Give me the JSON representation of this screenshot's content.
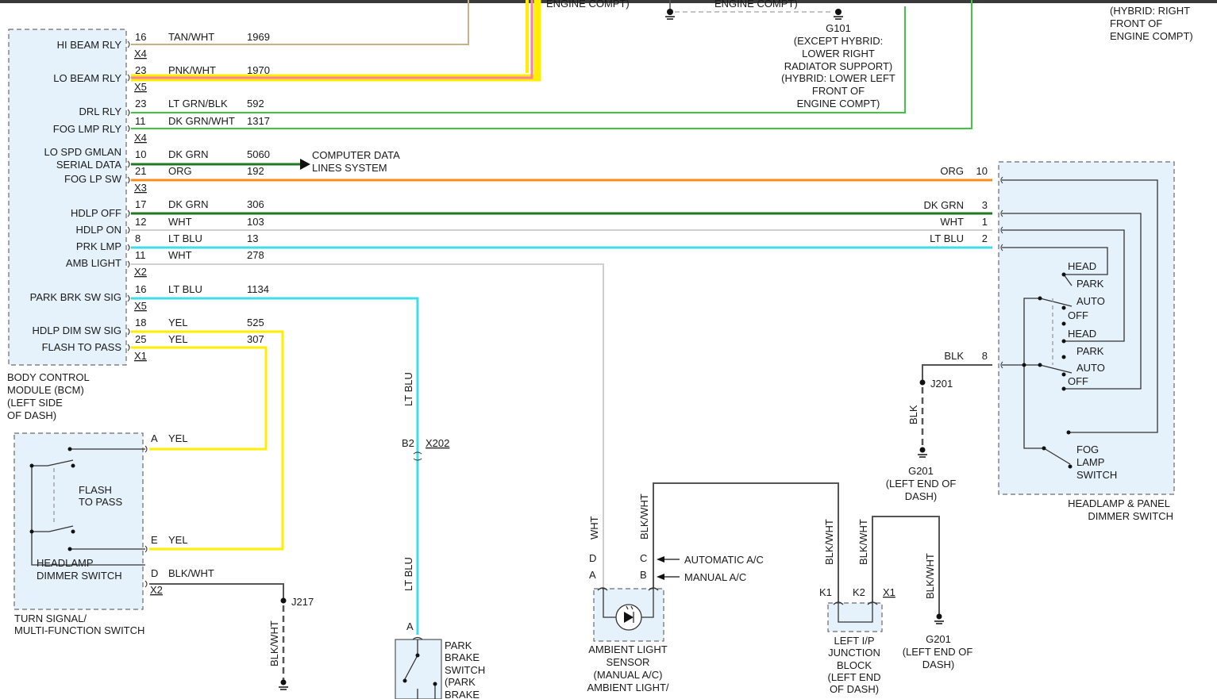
{
  "gnd_top": {
    "text": "ENGINE COMPT)",
    "text2": "ENGINE COMPT)"
  },
  "g101": {
    "id": "G101",
    "l1": "(EXCEPT HYBRID:",
    "l2": "LOWER RIGHT",
    "l3": "RADIATOR SUPPORT)",
    "l4": "(HYBRID: LOWER LEFT",
    "l5": "FRONT OF",
    "l6": "ENGINE COMPT)"
  },
  "topright": {
    "l1": "(HYBRID: RIGHT",
    "l2": "FRONT OF",
    "l3": "ENGINE COMPT)"
  },
  "bcm": {
    "name1": "BODY CONTROL",
    "name2": "MODULE (BCM)",
    "name3": "(LEFT SIDE",
    "name4": "OF DASH)",
    "pins": [
      {
        "label": "HI BEAM RLY",
        "pin": "16",
        "wire": "TAN/WHT",
        "circuit": "1969",
        "conn": "X4"
      },
      {
        "label": "LO BEAM RLY",
        "pin": "23",
        "wire": "PNK/WHT",
        "circuit": "1970",
        "conn": "X5"
      },
      {
        "label": "DRL RLY",
        "pin": "23",
        "wire": "LT GRN/BLK",
        "circuit": "592"
      },
      {
        "label": "FOG LMP RLY",
        "pin": "11",
        "wire": "DK GRN/WHT",
        "circuit": "1317",
        "conn": "X4"
      },
      {
        "label": "LO SPD GMLAN",
        "label2": "SERIAL DATA",
        "pin": "10",
        "wire": "DK GRN",
        "circuit": "5060"
      },
      {
        "label": "FOG LP SW",
        "pin": "21",
        "wire": "ORG",
        "circuit": "192",
        "conn": "X3"
      },
      {
        "label": "HDLP OFF",
        "pin": "17",
        "wire": "DK GRN",
        "circuit": "306"
      },
      {
        "label": "HDLP ON",
        "pin": "12",
        "wire": "WHT",
        "circuit": "103"
      },
      {
        "label": "PRK LMP",
        "pin": "8",
        "wire": "LT BLU",
        "circuit": "13"
      },
      {
        "label": "AMB LIGHT",
        "pin": "11",
        "wire": "WHT",
        "circuit": "278",
        "conn": "X2"
      },
      {
        "label": "PARK BRK SW SIG",
        "pin": "16",
        "wire": "LT BLU",
        "circuit": "1134",
        "conn": "X5"
      },
      {
        "label": "HDLP DIM SW SIG",
        "pin": "18",
        "wire": "YEL",
        "circuit": "525"
      },
      {
        "label": "FLASH TO PASS",
        "pin": "25",
        "wire": "YEL",
        "circuit": "307",
        "conn": "X1"
      }
    ]
  },
  "computer": {
    "l1": "COMPUTER DATA",
    "l2": "LINES SYSTEM"
  },
  "dimmer_pins": [
    {
      "wire": "ORG",
      "pin": "10"
    },
    {
      "wire": "DK GRN",
      "pin": "3"
    },
    {
      "wire": "WHT",
      "pin": "1"
    },
    {
      "wire": "LT BLU",
      "pin": "2"
    },
    {
      "wire": "BLK",
      "pin": "8"
    }
  ],
  "dimmer": {
    "positions": [
      "HEAD",
      "PARK",
      "AUTO",
      "OFF",
      "HEAD",
      "PARK",
      "AUTO",
      "OFF"
    ],
    "fog1": "FOG",
    "fog2": "LAMP",
    "fog3": "SWITCH",
    "name1": "HEADLAMP & PANEL",
    "name2": "DIMMER SWITCH"
  },
  "j201": {
    "id": "J201",
    "wire": "BLK",
    "g": "G201",
    "g1": "(LEFT END OF",
    "g2": "DASH)"
  },
  "tsw": {
    "pinA": "A",
    "wireA": "YEL",
    "pinE": "E",
    "wireE": "YEL",
    "pinD": "D",
    "wireD": "BLK/WHT",
    "conn": "X2",
    "flash1": "FLASH",
    "flash2": "TO PASS",
    "hd1": "HEADLAMP",
    "hd2": "DIMMER SWITCH",
    "name1": "TURN SIGNAL/",
    "name2": "MULTI-FUNCTION SWITCH"
  },
  "j217": {
    "id": "J217",
    "wire": "BLK/WHT"
  },
  "park": {
    "wire_top": "LT BLU",
    "pinB2": "B2",
    "conn": "X202",
    "wire_bot": "LT BLU",
    "pinA": "A",
    "l1": "PARK",
    "l2": "BRAKE",
    "l3": "SWITCH",
    "l4": "(PARK",
    "l5": "BRAKE"
  },
  "amb": {
    "wireD": "WHT",
    "wireC": "BLK/WHT",
    "pinD": "D",
    "pinC": "C",
    "pinA": "A",
    "pinB": "B",
    "auto": "AUTOMATIC A/C",
    "manual": "MANUAL A/C",
    "l1": "AMBIENT LIGHT",
    "l2": "SENSOR",
    "l3": "(MANUAL A/C)",
    "l4": "AMBIENT LIGHT/"
  },
  "jb": {
    "wire1": "BLK/WHT",
    "wire2": "BLK/WHT",
    "k1": "K1",
    "k2": "K2",
    "conn": "X1",
    "l1": "LEFT I/P",
    "l2": "JUNCTION",
    "l3": "BLOCK",
    "l4": "(LEFT END",
    "l5": "OF DASH)"
  },
  "g201b": {
    "wire": "BLK/WHT",
    "g": "G201",
    "l1": "(LEFT END OF",
    "l2": "DASH)"
  },
  "colors": {
    "tan": "#c8b08a",
    "pink": "#ff7fa0",
    "yellow": "#ffee00",
    "ltgrn": "#3fc53f",
    "dkgrn": "#1f7a1f",
    "org": "#ff8c1a",
    "wht": "#d0d0d0",
    "ltblu": "#3fdcea",
    "gray": "#666666"
  }
}
